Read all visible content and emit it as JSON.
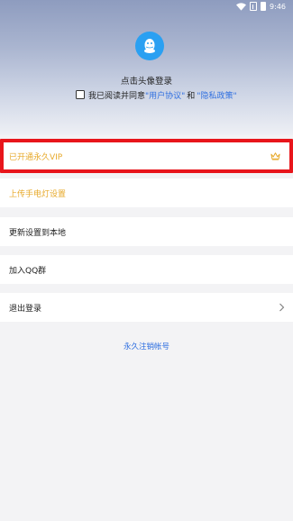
{
  "status_bar": {
    "time": "9:46"
  },
  "profile": {
    "login_prompt": "点击头像登录",
    "agreement_prefix": "我已阅读并同意",
    "user_agreement": "\"用户协议\"",
    "conjunction": "和",
    "privacy_policy": "\"隐私政策\""
  },
  "menu": {
    "vip_label": "已开通永久VIP",
    "upload_label": "上传手电灯设置",
    "update_label": "更新设置到本地",
    "join_qq_label": "加入QQ群",
    "logout_label": "退出登录"
  },
  "footer": {
    "cancel_account": "永久注销帐号"
  },
  "colors": {
    "accent_gold": "#e7a92a",
    "link_blue": "#2f6fe0",
    "highlight_red": "#e8151b",
    "avatar_blue": "#2aa0f2"
  },
  "icons": [
    "wifi-icon",
    "sim-icon",
    "battery-icon",
    "qq-penguin-icon",
    "crown-icon",
    "chevron-right-icon"
  ]
}
